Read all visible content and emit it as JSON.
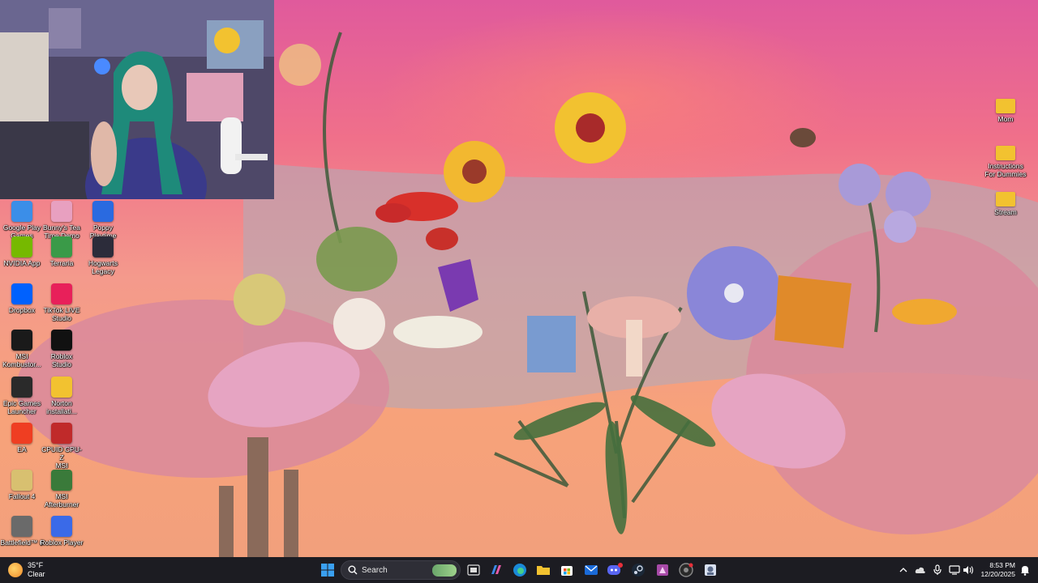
{
  "desktop": {
    "left_icons": [
      {
        "label": "Google Play\nGames",
        "icon": "google-play-games-icon",
        "color": "#3b8ee8"
      },
      {
        "label": "Bunny's Tea\nTime Demo",
        "icon": "bunnys-tea-time-icon",
        "color": "#e8a0c0"
      },
      {
        "label": "Poppy\nPlaytime",
        "icon": "poppy-playtime-icon",
        "color": "#2a6ae0"
      },
      {
        "label": "NVIDIA App",
        "icon": "nvidia-icon",
        "color": "#76b900"
      },
      {
        "label": "Terraria",
        "icon": "terraria-icon",
        "color": "#3a9a48"
      },
      {
        "label": "Hogwarts\nLegacy",
        "icon": "hogwarts-legacy-icon",
        "color": "#2c2c3a"
      },
      {
        "label": "Dropbox",
        "icon": "dropbox-icon",
        "color": "#0061fe"
      },
      {
        "label": "TikTok LIVE\nStudio",
        "icon": "tiktok-live-studio-icon",
        "color": "#e8205a"
      },
      {
        "label": "MSI\nKombustor...",
        "icon": "msi-kombustor-icon",
        "color": "#1a1a1a"
      },
      {
        "label": "Roblox\nStudio",
        "icon": "roblox-studio-icon",
        "color": "#111111"
      },
      {
        "label": "Epic Games\nLauncher",
        "icon": "epic-games-icon",
        "color": "#2a2a2a"
      },
      {
        "label": "Norton\ninstallati...",
        "icon": "folder-icon",
        "color": "#f2c230"
      },
      {
        "label": "EA",
        "icon": "ea-icon",
        "color": "#ef3e22"
      },
      {
        "label": "CPUID CPU-Z\nMSI",
        "icon": "cpu-z-icon",
        "color": "#c02a2a"
      },
      {
        "label": "Fallout 4",
        "icon": "fallout-4-icon",
        "color": "#d8c070"
      },
      {
        "label": "MSI\nAfterburner",
        "icon": "msi-afterburner-icon",
        "color": "#3a7a3a"
      },
      {
        "label": "Battlefield™ 6",
        "icon": "battlefield-icon",
        "color": "#6a6a6a"
      },
      {
        "label": "Roblox Player",
        "icon": "roblox-player-icon",
        "color": "#3a6ae8"
      }
    ],
    "right_icons": [
      {
        "label": "Mom",
        "icon": "folder-icon",
        "color": "#f2c230"
      },
      {
        "label": "Instructions\nFor Dummies",
        "icon": "folder-icon",
        "color": "#f2c230"
      },
      {
        "label": "Stream",
        "icon": "folder-icon",
        "color": "#f2c230"
      }
    ]
  },
  "taskbar": {
    "weather": {
      "temp": "35°F",
      "condition": "Clear"
    },
    "search_label": "Search",
    "clock": {
      "time": "8:53 PM",
      "date": "12/20/2025"
    },
    "pinned_apps": [
      "task-view-icon",
      "copilot-icon",
      "edge-icon",
      "file-explorer-icon",
      "microsoft-store-icon",
      "outlook-icon",
      "discord-icon",
      "steam-icon",
      "game-app-icon",
      "chrome-icon",
      "tiktok-studio-icon"
    ]
  }
}
